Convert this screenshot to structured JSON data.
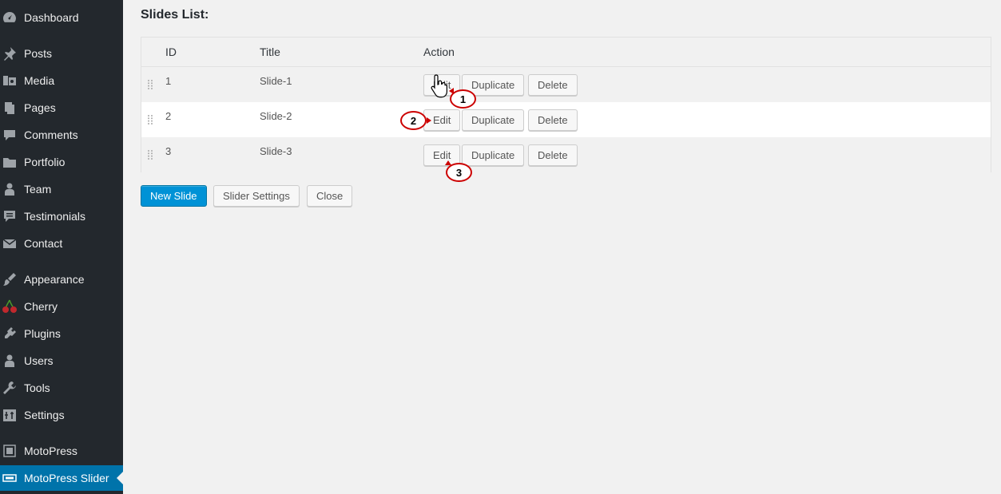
{
  "sidebar": {
    "items": [
      {
        "label": "Dashboard",
        "icon": "dashboard-icon"
      },
      {
        "label": "Posts",
        "icon": "pin-icon"
      },
      {
        "label": "Media",
        "icon": "media-icon"
      },
      {
        "label": "Pages",
        "icon": "pages-icon"
      },
      {
        "label": "Comments",
        "icon": "comment-icon"
      },
      {
        "label": "Portfolio",
        "icon": "folder-icon"
      },
      {
        "label": "Team",
        "icon": "person-icon"
      },
      {
        "label": "Testimonials",
        "icon": "testimonial-icon"
      },
      {
        "label": "Contact",
        "icon": "mail-icon"
      },
      {
        "label": "Appearance",
        "icon": "brush-icon"
      },
      {
        "label": "Cherry",
        "icon": "cherry-icon"
      },
      {
        "label": "Plugins",
        "icon": "plug-icon"
      },
      {
        "label": "Users",
        "icon": "users-icon"
      },
      {
        "label": "Tools",
        "icon": "wrench-icon"
      },
      {
        "label": "Settings",
        "icon": "settings-icon"
      },
      {
        "label": "MotoPress",
        "icon": "motopress-icon"
      },
      {
        "label": "MotoPress Slider",
        "icon": "slider-icon",
        "active": true
      }
    ]
  },
  "main": {
    "heading": "Slides List:",
    "table": {
      "headers": {
        "id": "ID",
        "title": "Title",
        "action": "Action"
      },
      "rows": [
        {
          "id": "1",
          "title": "Slide-1"
        },
        {
          "id": "2",
          "title": "Slide-2"
        },
        {
          "id": "3",
          "title": "Slide-3"
        }
      ],
      "actions": {
        "edit": "Edit",
        "duplicate": "Duplicate",
        "delete": "Delete"
      }
    },
    "buttons": {
      "new_slide": "New Slide",
      "slider_settings": "Slider Settings",
      "close": "Close"
    },
    "callouts": [
      "1",
      "2",
      "3"
    ]
  },
  "colors": {
    "sidebar_bg": "#23282d",
    "active": "#0073aa",
    "primary_button": "#0092d6",
    "callout": "#cc0000"
  }
}
